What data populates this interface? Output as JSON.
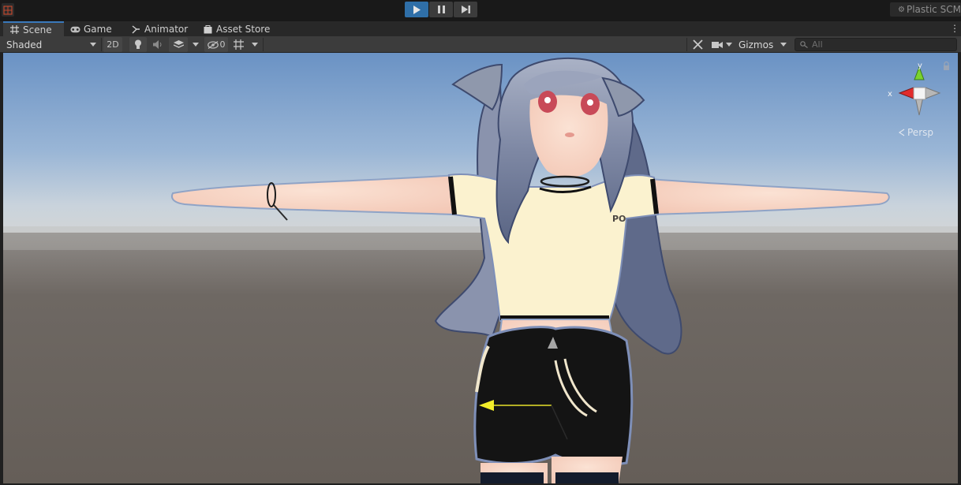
{
  "toolbar_top": {
    "play_icon": "play-icon",
    "pause_icon": "pause-icon",
    "step_icon": "step-icon",
    "plastic_label": "Plastic SCM"
  },
  "tabs": [
    {
      "label": "Scene",
      "icon": "grid-icon",
      "active": true
    },
    {
      "label": "Game",
      "icon": "gamepad-icon",
      "active": false
    },
    {
      "label": "Animator",
      "icon": "animator-icon",
      "active": false
    },
    {
      "label": "Asset Store",
      "icon": "bag-icon",
      "active": false
    }
  ],
  "scene_toolbar": {
    "shading_mode": "Shaded",
    "mode_2d": "2D",
    "hidden_count": "0",
    "gizmos_label": "Gizmos",
    "search_placeholder": "All"
  },
  "scene_gizmo": {
    "y_label": "y",
    "x_label": "x",
    "projection": "Persp"
  },
  "colors": {
    "accent": "#2f6fa8",
    "tab_highlight": "#3a79bb",
    "sky_top": "#6a92c4",
    "ground": "#6b6560"
  }
}
